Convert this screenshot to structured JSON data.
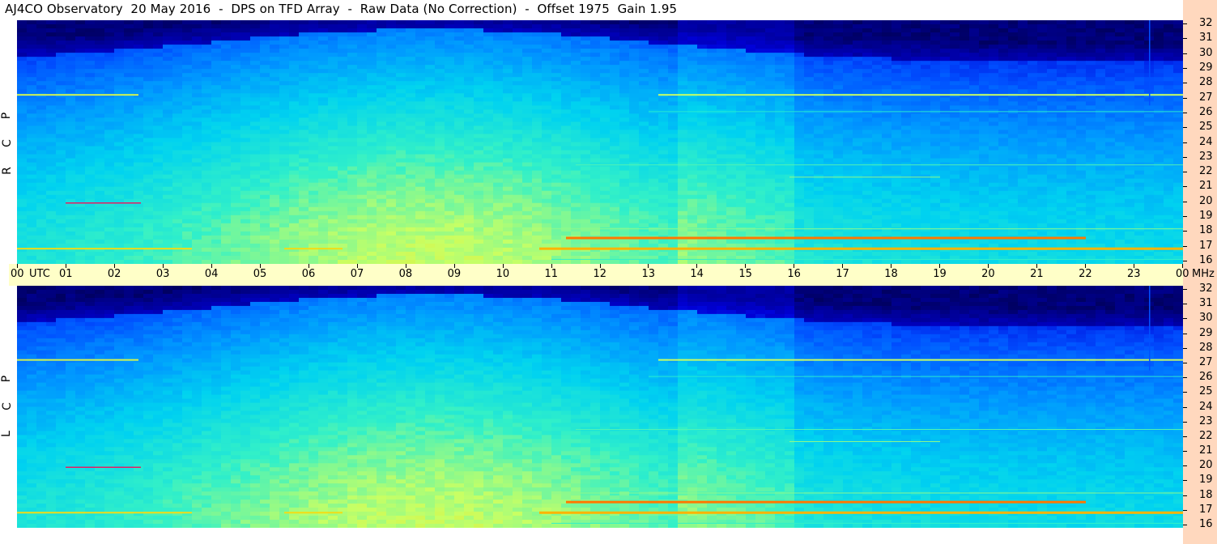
{
  "title": "AJ4CO Observatory  20 May 2016  -  DPS on TFD Array  -  Raw Data (No Correction)  -  Offset 1975  Gain 1.95",
  "chart_data": {
    "type": "heatmap",
    "title": "AJ4CO Observatory  20 May 2016  -  DPS on TFD Array  -  Raw Data (No Correction)  -  Offset 1975  Gain 1.95",
    "x_axis": {
      "units": "UTC",
      "tick_labels": [
        "00",
        "01",
        "02",
        "03",
        "04",
        "05",
        "06",
        "07",
        "08",
        "09",
        "10",
        "11",
        "12",
        "13",
        "14",
        "15",
        "16",
        "17",
        "18",
        "19",
        "20",
        "21",
        "22",
        "23",
        "00"
      ],
      "range_hours": [
        0,
        24
      ]
    },
    "y_axis": {
      "units": "MHz",
      "tick_labels": [
        "16",
        "17",
        "18",
        "19",
        "20",
        "21",
        "22",
        "23",
        "24",
        "25",
        "26",
        "27",
        "28",
        "29",
        "30",
        "31",
        "32"
      ],
      "range_mhz": [
        16,
        32
      ]
    },
    "panels": [
      {
        "name": "RCP",
        "label_letters": [
          "R",
          "C",
          "P"
        ]
      },
      {
        "name": "LCP",
        "label_letters": [
          "L",
          "C",
          "P"
        ]
      }
    ],
    "colormap": [
      "#000020",
      "#00008c",
      "#0000d8",
      "#0050ff",
      "#0096ff",
      "#00d2f0",
      "#32f0c8",
      "#c8ff64",
      "#ffd200",
      "#ff3c00",
      "#c800c8"
    ],
    "features": {
      "strong_bands_mhz": [
        17,
        17.7,
        27.1
      ],
      "bright_interval_utc": [
        10.75,
        22.6
      ],
      "daytime_hump_peak_utc": 8.5
    }
  }
}
